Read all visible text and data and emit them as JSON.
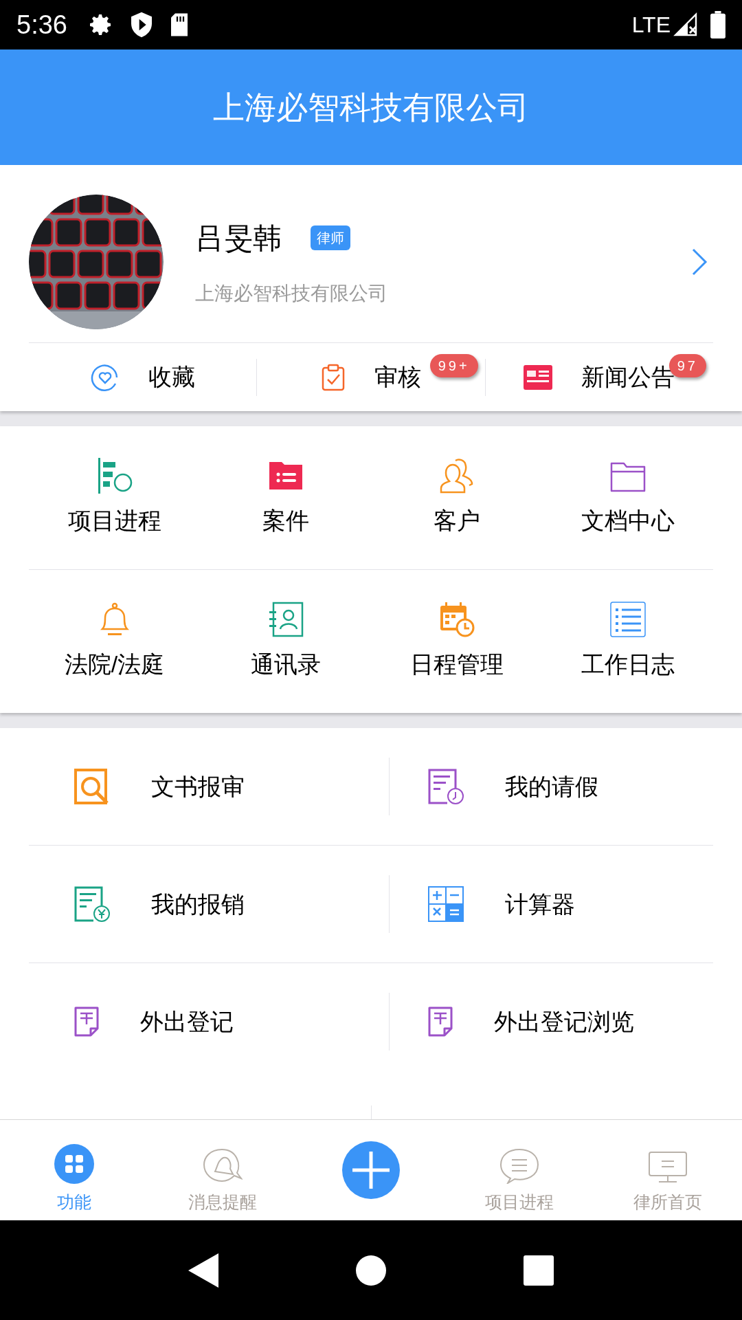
{
  "status_bar": {
    "time": "5:36",
    "network": "LTE"
  },
  "header": {
    "title": "上海必智科技有限公司"
  },
  "profile": {
    "name": "吕旻韩",
    "role": "律师",
    "company": "上海必智科技有限公司"
  },
  "shortcuts": [
    {
      "kind": "favorite",
      "label": "收藏"
    },
    {
      "kind": "review",
      "label": "审核",
      "badge": "99+"
    },
    {
      "kind": "news",
      "label": "新闻公告",
      "badge": "97"
    }
  ],
  "grid": [
    {
      "kind": "progress",
      "label": "项目进程"
    },
    {
      "kind": "case",
      "label": "案件"
    },
    {
      "kind": "client",
      "label": "客户"
    },
    {
      "kind": "docs",
      "label": "文档中心"
    },
    {
      "kind": "court",
      "label": "法院/法庭"
    },
    {
      "kind": "contacts",
      "label": "通讯录"
    },
    {
      "kind": "schedule",
      "label": "日程管理"
    },
    {
      "kind": "log",
      "label": "工作日志"
    }
  ],
  "list": [
    {
      "kind": "doc-review",
      "label": "文书报审"
    },
    {
      "kind": "leave",
      "label": "我的请假"
    },
    {
      "kind": "expense",
      "label": "我的报销"
    },
    {
      "kind": "calculator",
      "label": "计算器"
    },
    {
      "kind": "tax",
      "label": "外出登记"
    },
    {
      "kind": "tax",
      "label": "外出登记浏览"
    }
  ],
  "bottom_nav": [
    {
      "kind": "grid",
      "label": "功能",
      "selected": true
    },
    {
      "kind": "bell",
      "label": "消息提醒",
      "selected": false
    },
    {
      "kind": "plus"
    },
    {
      "kind": "chat",
      "label": "项目进程",
      "selected": false
    },
    {
      "kind": "monitor",
      "label": "律所首页",
      "selected": false
    }
  ]
}
